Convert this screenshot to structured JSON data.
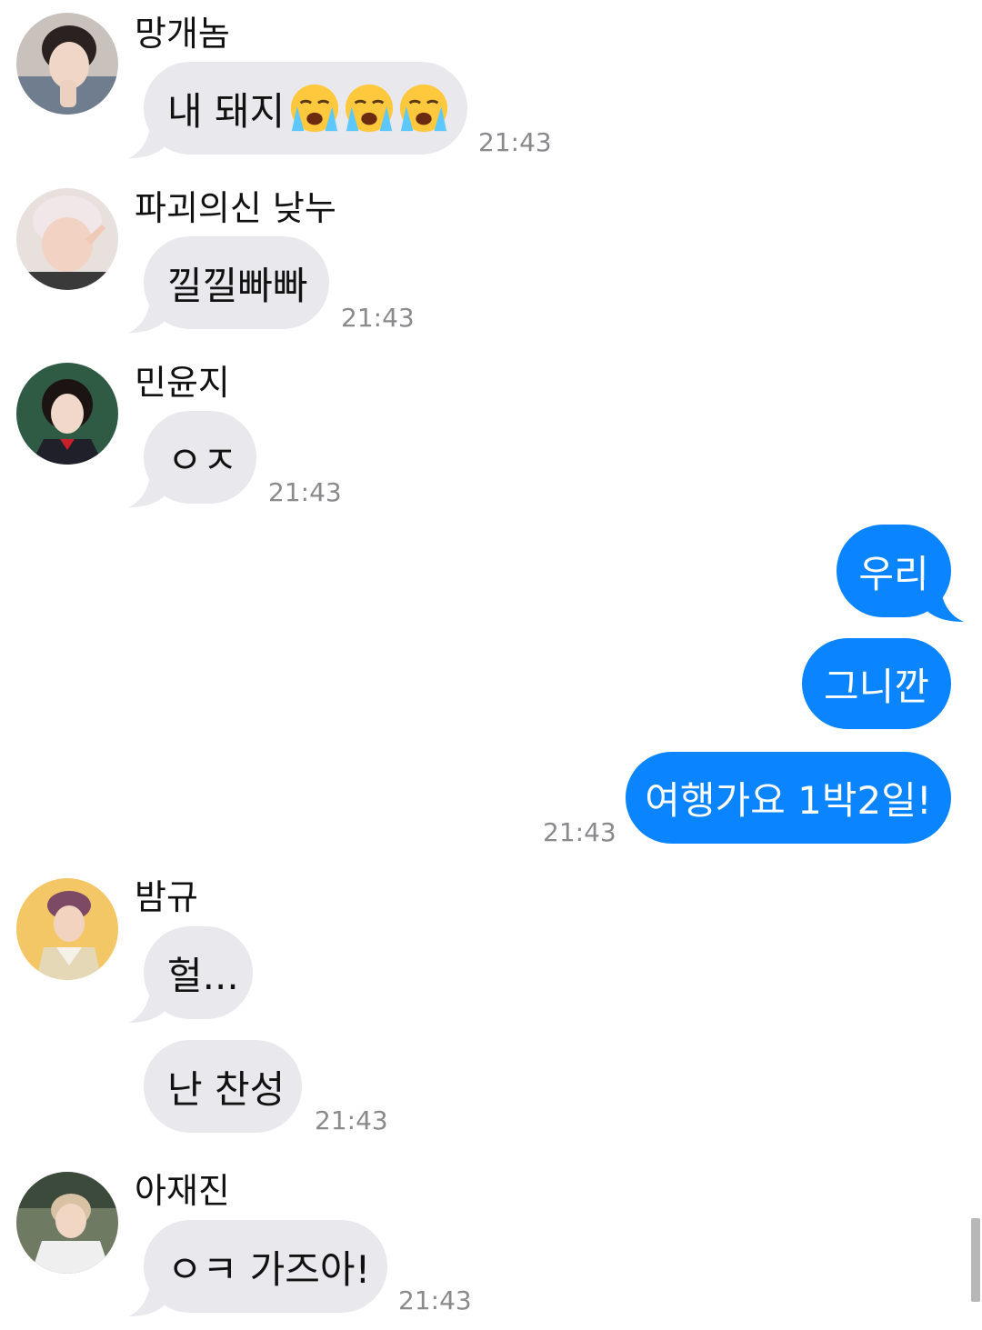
{
  "messages": [
    {
      "sender": "망개놈",
      "text": "내 돼지",
      "emoji": [
        "loudly-crying-face",
        "loudly-crying-face",
        "loudly-crying-face"
      ],
      "time": "21:43"
    },
    {
      "sender": "파괴의신 낮누",
      "text": "낄낄빠빠",
      "time": "21:43"
    },
    {
      "sender": "민윤지",
      "text": "ㅇㅈ",
      "time": "21:43"
    },
    {
      "outgoing": [
        "우리",
        "그니깐",
        "여행가요 1박2일!"
      ],
      "time": "21:43"
    },
    {
      "sender": "밤규",
      "texts": [
        "헐...",
        "난 찬성"
      ],
      "time": "21:43"
    },
    {
      "sender": "아재진",
      "text": "ㅇㅋ 가즈아!",
      "time": "21:43"
    }
  ],
  "colors": {
    "incoming_bubble": "#e8e8ed",
    "outgoing_bubble": "#0a84ff",
    "timestamp": "#8a8a8e"
  }
}
